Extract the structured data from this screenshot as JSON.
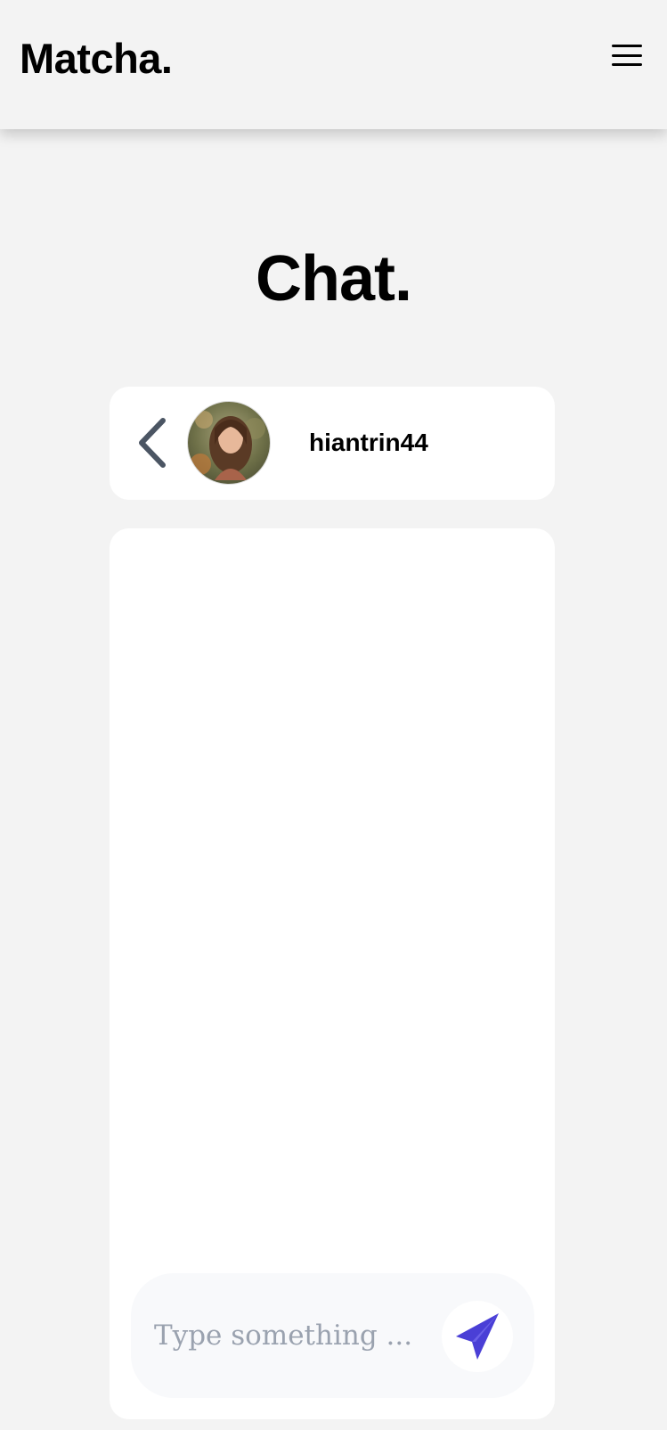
{
  "header": {
    "brand": "Matcha.",
    "menu_icon": "hamburger-menu-icon"
  },
  "page": {
    "title": "Chat."
  },
  "chat": {
    "back_icon": "chevron-left-icon",
    "contact": {
      "username": "hiantrin44",
      "avatar": "profile-photo"
    },
    "messages": [],
    "composer": {
      "placeholder": "Type something ...",
      "value": "",
      "send_icon": "paper-plane-icon"
    }
  },
  "colors": {
    "page_bg": "#f3f3f3",
    "card_bg": "#ffffff",
    "composer_bg": "#f8f9fb",
    "send_accent": "#4a3fd6",
    "back_icon": "#4b5563"
  }
}
